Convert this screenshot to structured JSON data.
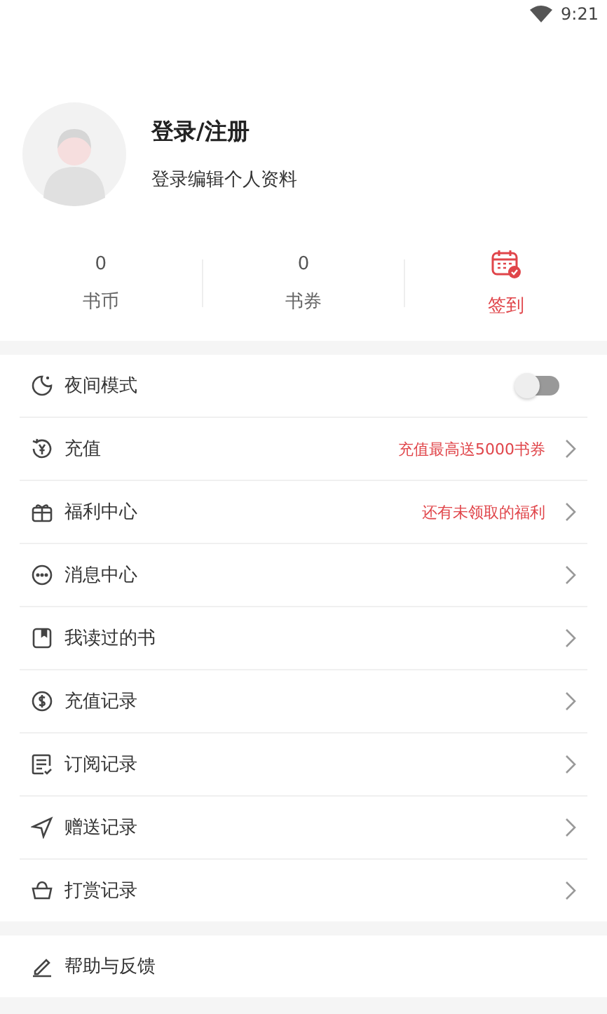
{
  "status_bar": {
    "time": "9:21"
  },
  "profile": {
    "name": "登录/注册",
    "subtitle": "登录编辑个人资料"
  },
  "stats": [
    {
      "kind": "count",
      "value": "0",
      "label": "书币"
    },
    {
      "kind": "count",
      "value": "0",
      "label": "书券"
    },
    {
      "kind": "checkin",
      "label": "签到"
    }
  ],
  "sections": [
    {
      "items": [
        {
          "kind": "toggle",
          "label": "夜间模式",
          "on": false
        },
        {
          "kind": "link",
          "label": "充值",
          "note": "充值最高送5000书券"
        },
        {
          "kind": "link",
          "label": "福利中心",
          "note": "还有未领取的福利"
        },
        {
          "kind": "link",
          "label": "消息中心"
        },
        {
          "kind": "link",
          "label": "我读过的书"
        },
        {
          "kind": "link",
          "label": "充值记录"
        },
        {
          "kind": "link",
          "label": "订阅记录"
        },
        {
          "kind": "link",
          "label": "赠送记录"
        },
        {
          "kind": "link",
          "label": "打赏记录"
        }
      ]
    },
    {
      "items": [
        {
          "kind": "plain",
          "label": "帮助与反馈"
        }
      ]
    }
  ]
}
